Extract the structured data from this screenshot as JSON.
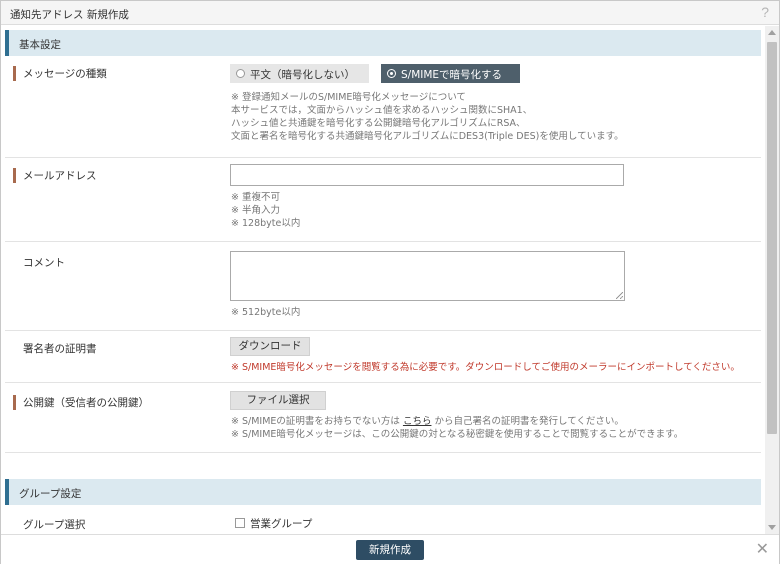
{
  "dialog": {
    "title": "通知先アドレス 新規作成",
    "help_icon": "?"
  },
  "sections": {
    "basic": "基本設定",
    "group": "グループ設定"
  },
  "message_type": {
    "label": "メッセージの種類",
    "options": [
      "平文（暗号化しない）",
      "S/MIMEで暗号化する"
    ],
    "selected": "S/MIMEで暗号化する",
    "notes": [
      "※ 登録通知メールのS/MIME暗号化メッセージについて",
      "本サービスでは，文面からハッシュ値を求めるハッシュ関数にSHA1、",
      "ハッシュ値と共通鍵を暗号化する公開鍵暗号化アルゴリズムにRSA、",
      "文面と署名を暗号化する共通鍵暗号化アルゴリズムにDES3(Triple DES)を使用しています。"
    ]
  },
  "email": {
    "label": "メールアドレス",
    "value": "",
    "notes": [
      "※ 重複不可",
      "※ 半角入力",
      "※ 128byte以内"
    ]
  },
  "comment": {
    "label": "コメント",
    "value": "",
    "note": "※ 512byte以内"
  },
  "signer_cert": {
    "label": "署名者の証明書",
    "button": "ダウンロード",
    "note": "※ S/MIME暗号化メッセージを閲覧する為に必要です。ダウンロードしてご使用のメーラーにインポートしてください。"
  },
  "public_key": {
    "label": "公開鍵（受信者の公開鍵）",
    "button": "ファイル選択",
    "note1_before": "※ S/MIMEの証明書をお持ちでない方は ",
    "note1_link": "こちら",
    "note1_after": " から自己署名の証明書を発行してください。",
    "note2": "※ S/MIME暗号化メッセージは、この公開鍵の対となる秘密鍵を使用することで閲覧することができます。"
  },
  "group": {
    "label": "グループ選択",
    "checkbox_label": "営業グループ",
    "checked": false
  },
  "footer": {
    "create_button": "新規作成",
    "close_icon": "✕"
  },
  "colors": {
    "section_bg": "#dbe9f0",
    "section_accent": "#2f6f91",
    "required_marker": "#a86a4e",
    "primary_button": "#2e4d64",
    "warning_text": "#c0392b"
  }
}
